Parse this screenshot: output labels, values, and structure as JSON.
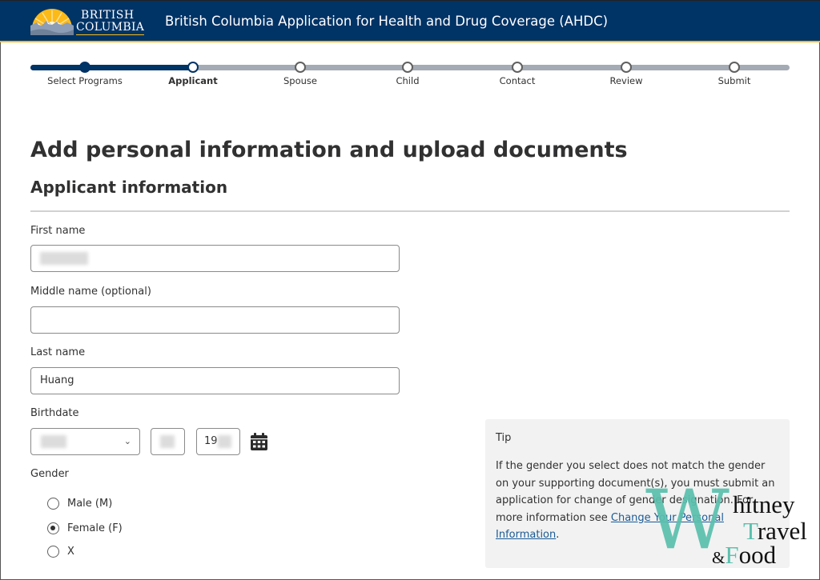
{
  "header": {
    "logo_line1": "British",
    "logo_line2": "Columbia",
    "title": "British Columbia Application for Health and Drug Coverage (AHDC)",
    "colors": {
      "bar": "#003366",
      "accent": "#fcba19"
    }
  },
  "stepper": {
    "steps": [
      {
        "label": "Select Programs",
        "state": "done"
      },
      {
        "label": "Applicant",
        "state": "current"
      },
      {
        "label": "Spouse",
        "state": "pending"
      },
      {
        "label": "Child",
        "state": "pending"
      },
      {
        "label": "Contact",
        "state": "pending"
      },
      {
        "label": "Review",
        "state": "pending"
      },
      {
        "label": "Submit",
        "state": "pending"
      }
    ],
    "current_index": 1
  },
  "page": {
    "title": "Add personal information and upload documents",
    "section_title": "Applicant information"
  },
  "form": {
    "first_name": {
      "label": "First name",
      "value": "[redacted]"
    },
    "middle_name": {
      "label": "Middle name (optional)",
      "value": ""
    },
    "last_name": {
      "label": "Last name",
      "value": "Huang"
    },
    "birthdate": {
      "label": "Birthdate",
      "month": "[redacted]",
      "day": "[redacted]",
      "year_prefix": "19"
    },
    "gender": {
      "label": "Gender",
      "options": [
        {
          "label": "Male (M)",
          "checked": false
        },
        {
          "label": "Female (F)",
          "checked": true
        },
        {
          "label": "X",
          "checked": false
        }
      ]
    }
  },
  "tip": {
    "title": "Tip",
    "body_before_link": "If the gender you select does not match the gender on your supporting document(s), you must submit an application for change of gender designation. For more information see ",
    "link_text": "Change Your Personal Information",
    "body_after_link": "."
  },
  "watermark": {
    "initial": "W",
    "line1": "hitney",
    "line2_initial": "T",
    "line2": "ravel",
    "line3_amp": "&",
    "line3_initial": "F",
    "line3": "ood",
    "color": "#5bc0ae"
  }
}
